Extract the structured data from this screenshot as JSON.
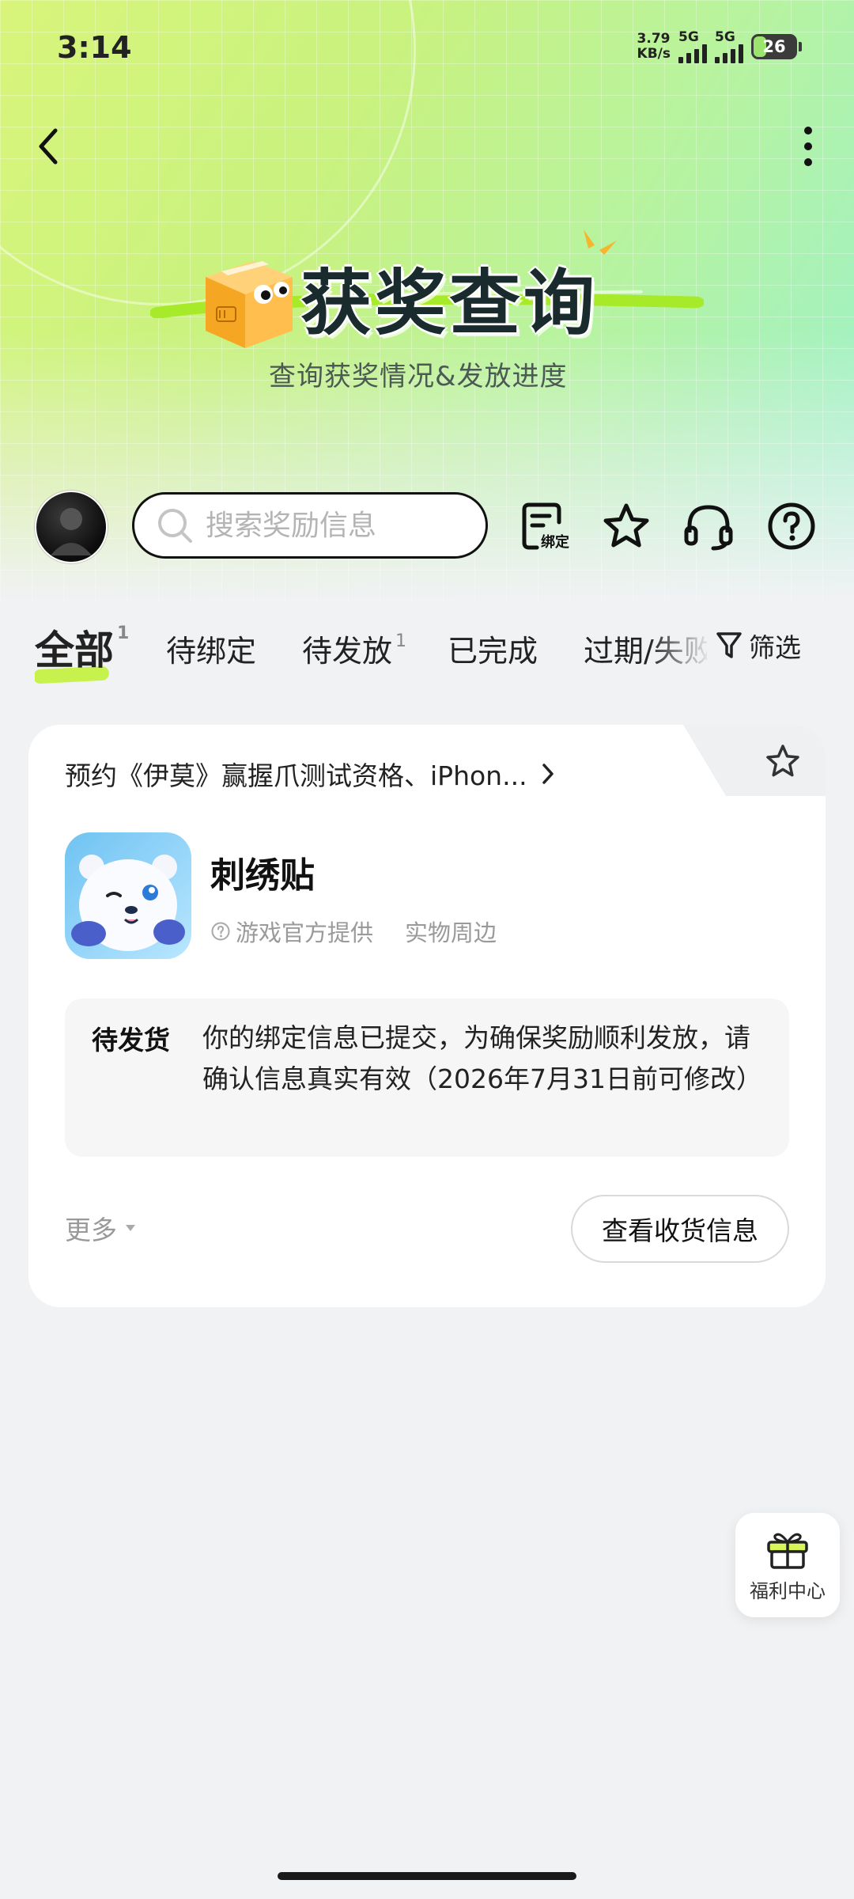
{
  "status_bar": {
    "time": "3:14",
    "net_speed_value": "3.79",
    "net_speed_unit": "KB/s",
    "signal_1_label": "5G",
    "signal_2_label": "5G",
    "battery": "26"
  },
  "hero": {
    "title": "获奖查询",
    "subtitle": "查询获奖情况&发放进度"
  },
  "search": {
    "placeholder": "搜索奖励信息"
  },
  "toolbar": {
    "bind_label": "绑定"
  },
  "tabs": [
    {
      "label": "全部",
      "count": "1",
      "active": true
    },
    {
      "label": "待绑定",
      "count": "",
      "active": false
    },
    {
      "label": "待发放",
      "count": "1",
      "active": false
    },
    {
      "label": "已完成",
      "count": "",
      "active": false
    },
    {
      "label": "过期/失败",
      "count": "",
      "active": false
    }
  ],
  "filter_label": "筛选",
  "card": {
    "event_title": "预约《伊莫》赢握爪测试资格、iPhon...",
    "item_name": "刺绣贴",
    "provider": "游戏官方提供",
    "category": "实物周边",
    "status_label": "待发货",
    "status_text": "你的绑定信息已提交，为确保奖励顺利发放，请确认信息真实有效（2026年7月31日前可修改）",
    "more_label": "更多",
    "action_button": "查看收货信息"
  },
  "welfare": {
    "label": "福利中心"
  },
  "colors": {
    "accent_green": "#c7f24d",
    "header_gradient_start": "#d8f57a",
    "header_gradient_end": "#9af1cf"
  }
}
